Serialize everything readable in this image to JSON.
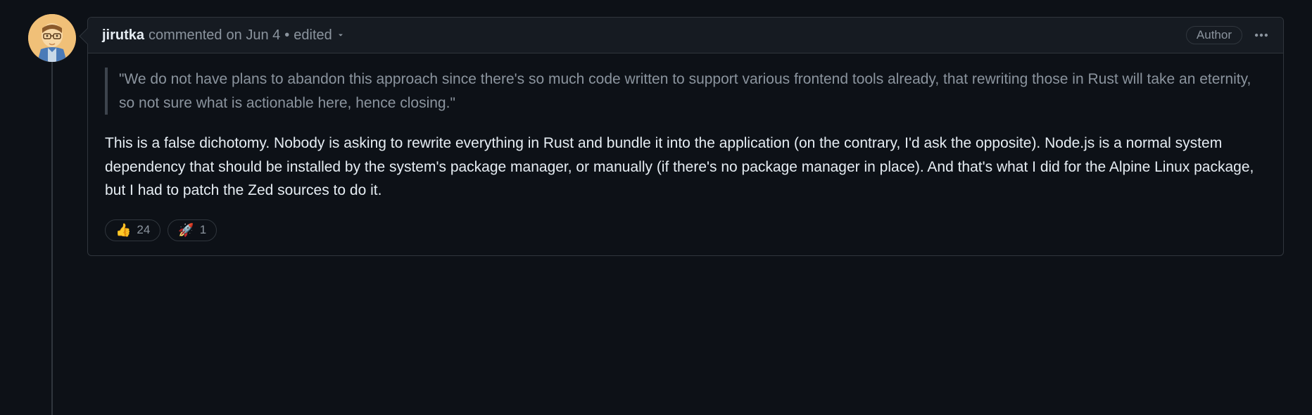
{
  "comment": {
    "author": "jirutka",
    "action_text": "commented",
    "timestamp_text": "on Jun 4",
    "separator": "•",
    "edited_text": "edited",
    "badge": "Author",
    "quote": "\"We do not have plans to abandon this approach since there's so much code written to support various frontend tools already, that rewriting those in Rust will take an eternity, so not sure what is actionable here, hence closing.\"",
    "body": "This is a false dichotomy. Nobody is asking to rewrite everything in Rust and bundle it into the application (on the contrary, I'd ask the opposite). Node.js is a normal system dependency that should be installed by the system's package manager, or manually (if there's no package manager in place). And that's what I did for the Alpine Linux package, but I had to patch the Zed sources to do it.",
    "reactions": [
      {
        "emoji": "👍",
        "count": "24"
      },
      {
        "emoji": "🚀",
        "count": "1"
      }
    ]
  }
}
